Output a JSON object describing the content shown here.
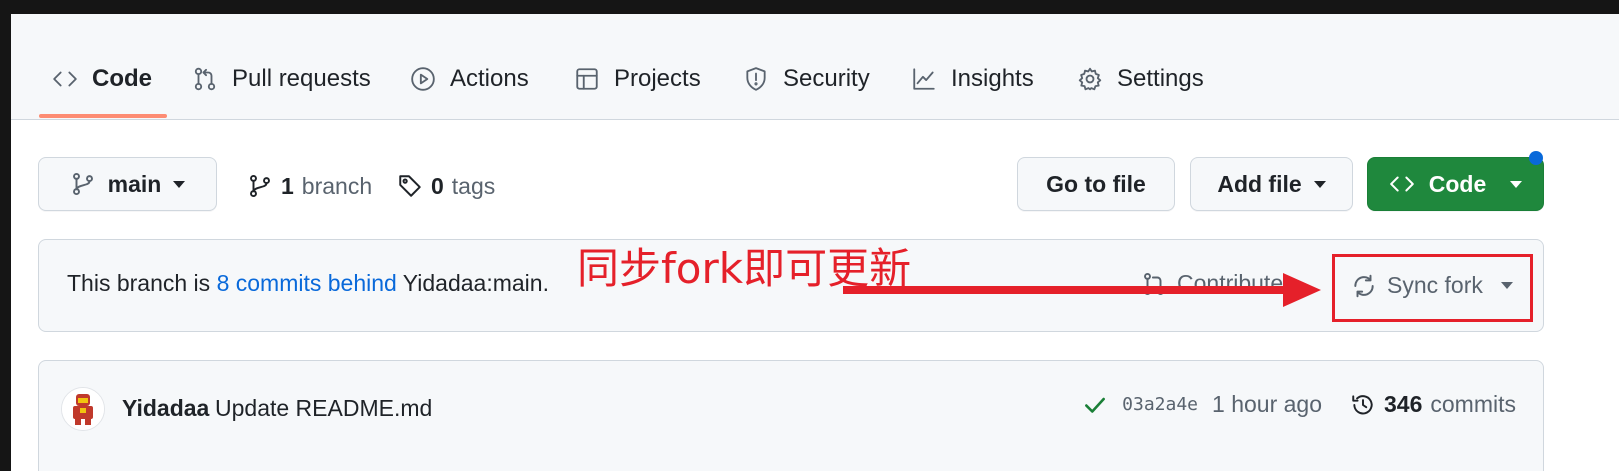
{
  "repo_nav": {
    "tabs": [
      {
        "label": "Code",
        "icon": "code-icon",
        "active": true
      },
      {
        "label": "Pull requests",
        "icon": "git-pull-request-icon",
        "active": false
      },
      {
        "label": "Actions",
        "icon": "play-icon",
        "active": false
      },
      {
        "label": "Projects",
        "icon": "table-icon",
        "active": false
      },
      {
        "label": "Security",
        "icon": "shield-icon",
        "active": false
      },
      {
        "label": "Insights",
        "icon": "graph-icon",
        "active": false
      },
      {
        "label": "Settings",
        "icon": "gear-icon",
        "active": false
      }
    ]
  },
  "toolbar": {
    "branch_label": "main",
    "branch_count": "1",
    "branch_word": "branch",
    "tag_count": "0",
    "tag_word": "tags",
    "go_to_file": "Go to file",
    "add_file": "Add file",
    "code_button": "Code"
  },
  "banner": {
    "prefix": "This branch is ",
    "behind_link": "8 commits behind",
    "suffix": " Yidadaa:main.",
    "contribute": "Contribute",
    "sync_fork": "Sync fork"
  },
  "annotation": {
    "text": "同步fork即可更新",
    "color": "#e5202a"
  },
  "latest_commit": {
    "author": "Yidadaa",
    "message": "Update README.md",
    "sha": "03a2a4e",
    "time": "1 hour ago",
    "commit_count": "346",
    "commit_word": "commits"
  },
  "colors": {
    "accent_underline": "#fd8c73",
    "link": "#0969da",
    "primary_button": "#1f883d"
  }
}
